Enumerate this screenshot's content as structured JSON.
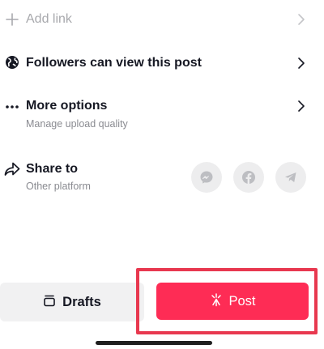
{
  "rows": {
    "add_link": {
      "title": "Add link"
    },
    "privacy": {
      "title": "Followers can view this post"
    },
    "more_options": {
      "title": "More options",
      "subtitle": "Manage upload quality"
    },
    "share_to": {
      "title": "Share to",
      "subtitle": "Other platform",
      "targets": [
        {
          "icon": "messenger-icon"
        },
        {
          "icon": "facebook-icon"
        },
        {
          "icon": "telegram-icon"
        }
      ]
    }
  },
  "actions": {
    "drafts_label": "Drafts",
    "post_label": "Post"
  },
  "colors": {
    "accent": "#fe2c55",
    "highlight": "#e8384f",
    "muted_text": "#8a8b91",
    "icon_grey": "#ededee"
  }
}
